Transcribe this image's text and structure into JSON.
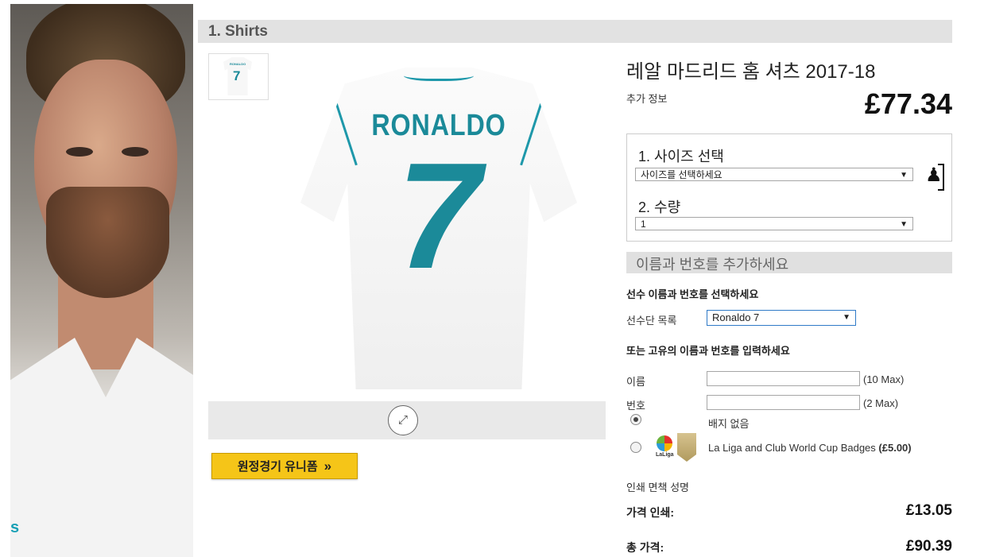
{
  "header": {
    "title": "1. Shirts"
  },
  "product": {
    "title": "레알 마드리드 홈 셔츠 2017-18",
    "more_info": "추가 정보",
    "price": "£77.34",
    "jersey_name": "RONALDO",
    "jersey_number": "7"
  },
  "away_button": {
    "label": "원정경기 유니폼",
    "chevron": "»"
  },
  "zoom": {
    "icon": "expand-icon"
  },
  "size_section": {
    "size_label": "1. 사이즈 선택",
    "size_value": "사이즈를 선택하세요",
    "qty_label": "2. 수량",
    "qty_value": "1",
    "size_guide_icon": "size-guide-icon"
  },
  "personalise": {
    "heading": "이름과 번호를 추가하세요",
    "choose_player": "선수 이름과 번호를 선택하세요",
    "squad_label": "선수단 목록",
    "squad_value": "Ronaldo 7",
    "custom_heading": "또는 고유의 이름과 번호를 입력하세요",
    "name_label": "이름",
    "name_value": "",
    "name_hint": "(10 Max)",
    "number_label": "번호",
    "number_value": "",
    "number_hint": "(2 Max)"
  },
  "badges": {
    "none_label": "배지 없음",
    "laliga_label": "La Liga and Club World Cup Badges",
    "laliga_price": "(£5.00)",
    "laliga_badge_text": "LaLiga",
    "selected": "none"
  },
  "disclaimer": "인쇄 면책 성명",
  "summary": {
    "print_label": "가격 인쇄:",
    "print_value": "£13.05",
    "total_label": "총 가격:",
    "total_value": "£90.39"
  },
  "banner": {
    "brand_text": "s"
  },
  "colors": {
    "accent_teal": "#1b8a99",
    "button_yellow": "#f5c518",
    "bar_grey": "#e2e2e2"
  }
}
